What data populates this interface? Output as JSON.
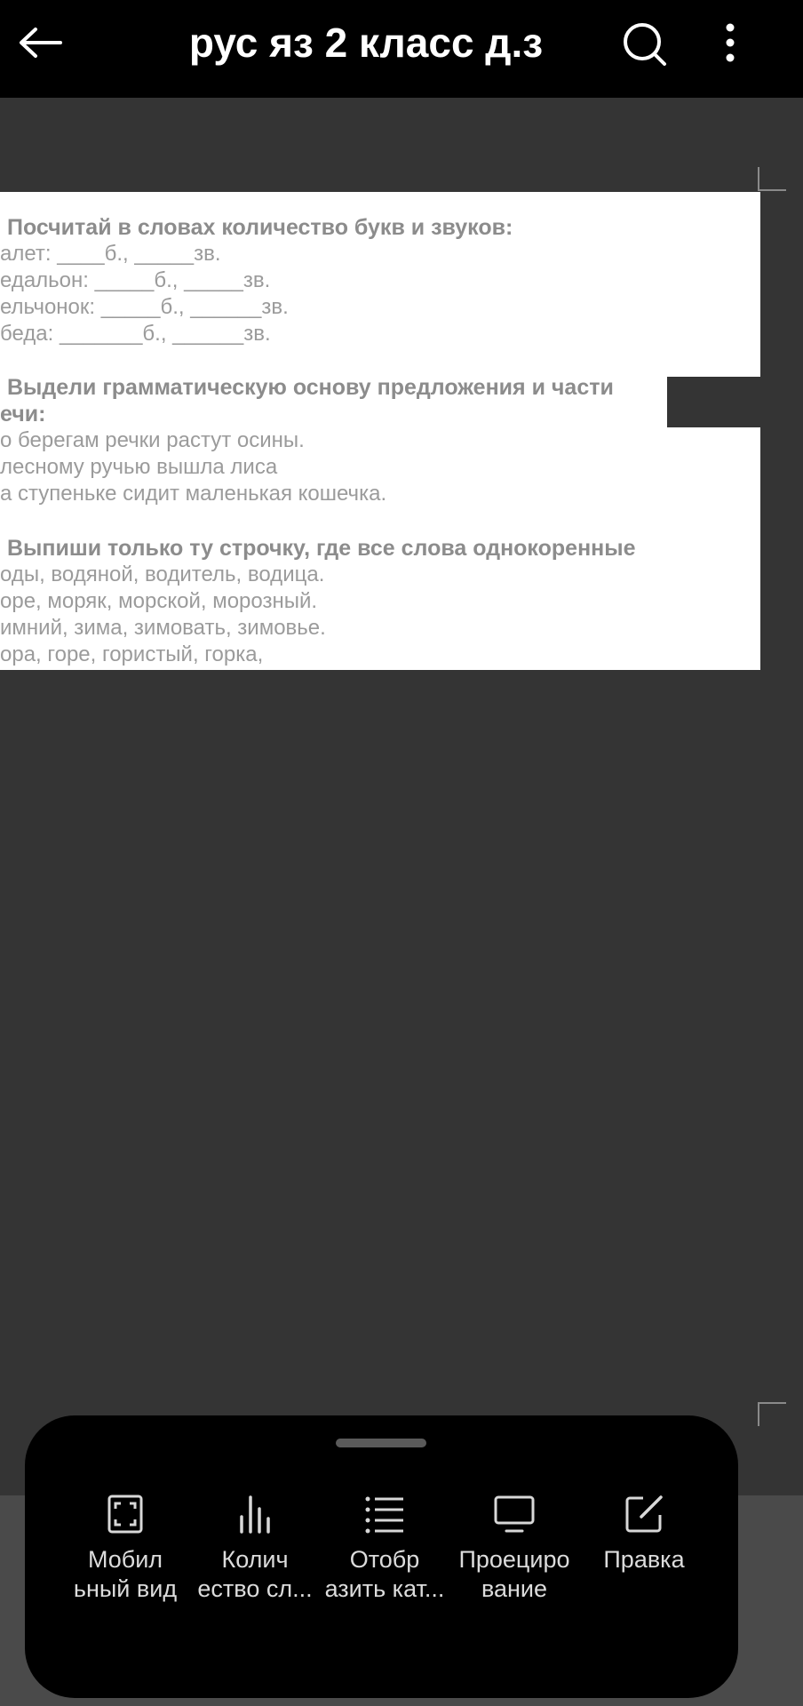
{
  "header": {
    "title": "рус яз 2 класс д.з",
    "back_icon": "arrow-left-icon",
    "search_icon": "search-icon",
    "more_icon": "more-vertical-icon"
  },
  "document": {
    "lines": [
      "Посчитай в словах количество букв и звуков:",
      "алет:  ____б., _____зв.",
      "едальон: _____б., _____зв.",
      "ельчонок: _____б., ______зв.",
      "беда: _______б., ______зв.",
      "Выдели грамматическую основу предложения и части",
      "ечи:",
      "о берегам речки растут осины.",
      "лесному ручью вышла лиса",
      "а ступеньке сидит маленькая кошечка.",
      "Выпиши только ту строчку, где все слова  однокоренные",
      "оды, водяной, водитель,  водица.",
      "оре, моряк, морской, морозный.",
      "имний, зима, зимовать, зимовье.",
      "ора, горе, гористый, горка,"
    ]
  },
  "bottom_sheet": {
    "actions": [
      {
        "label": "Мобил\nьный вид",
        "icon": "fullscreen-frame-icon"
      },
      {
        "label": "Колич\nество сл...",
        "icon": "bar-chart-icon"
      },
      {
        "label": "Отобр\nазить кат...",
        "icon": "list-icon"
      },
      {
        "label": "Проециро\nвание",
        "icon": "monitor-icon"
      },
      {
        "label": "Правка",
        "icon": "edit-icon"
      }
    ]
  },
  "colors": {
    "top_bar": "#000000",
    "background": "#343434",
    "sheet": "#000000",
    "doc_text": "#9b9b9b"
  }
}
